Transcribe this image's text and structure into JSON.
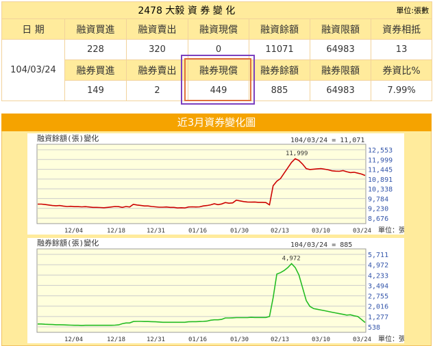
{
  "summary": {
    "title": "2478 大毅 資 券 變 化",
    "unit": "單位:張數",
    "date_header": "日 期",
    "date": "104/03/24",
    "margin_headers": [
      "融資買進",
      "融資賣出",
      "融資現償",
      "融資餘額",
      "融資限額",
      "資券相抵"
    ],
    "margin_values": [
      "228",
      "320",
      "0",
      "11071",
      "64983",
      "13"
    ],
    "short_headers": [
      "融券買進",
      "融券賣出",
      "融券現償",
      "融券餘額",
      "融券限額",
      "券資比%"
    ],
    "short_values": [
      "149",
      "2",
      "449",
      "885",
      "64983",
      "7.99%"
    ]
  },
  "panel": {
    "title": "近3月資券變化圖"
  },
  "chart_data": [
    {
      "type": "line",
      "title": "融資餘額(張)變化",
      "readout": "104/03/24 = 11,071",
      "peak_label": "11,999",
      "unit_label": "單位：張",
      "x_ticks": [
        "12/04",
        "12/18",
        "12/31",
        "01/16",
        "01/30",
        "02/13",
        "03/10",
        "03/24"
      ],
      "y_ticks": [
        "12,553",
        "11,999",
        "11,445",
        "10,891",
        "10,338",
        "9,784",
        "9,230",
        "8,676"
      ],
      "ylim": [
        8400,
        12800
      ],
      "color": "#cc0000",
      "grid": true,
      "values": [
        9480,
        9480,
        9460,
        9430,
        9400,
        9390,
        9400,
        9370,
        9350,
        9360,
        9340,
        9340,
        9330,
        9340,
        9320,
        9300,
        9300,
        9290,
        9280,
        9300,
        9320,
        9350,
        9340,
        9300,
        9350,
        9320,
        9470,
        9430,
        9410,
        9380,
        9380,
        9350,
        9330,
        9310,
        9310,
        9320,
        9300,
        9300,
        9270,
        9280,
        9270,
        9320,
        9330,
        9320,
        9330,
        9380,
        9400,
        9440,
        9500,
        9450,
        9490,
        9570,
        9530,
        9550,
        9700,
        9660,
        9620,
        9600,
        9590,
        9600,
        9580,
        9580,
        9570,
        9440,
        10500,
        10750,
        10900,
        11200,
        11500,
        11800,
        11999,
        11900,
        11700,
        11450,
        11400,
        11420,
        11440,
        11450,
        11420,
        11380,
        11330,
        11310,
        11300,
        11340,
        11280,
        11230,
        11250,
        11200,
        11150,
        11071
      ]
    },
    {
      "type": "line",
      "title": "融券餘額(張)變化",
      "readout": "104/03/24 = 885",
      "peak_label": "4,972",
      "unit_label": "單位：張",
      "x_ticks": [
        "12/04",
        "12/18",
        "12/31",
        "01/16",
        "01/30",
        "02/13",
        "03/10",
        "03/24"
      ],
      "y_ticks": [
        "5,711",
        "4,972",
        "4,233",
        "3,494",
        "2,755",
        "2,016",
        "1,277",
        "538"
      ],
      "ylim": [
        200,
        6000
      ],
      "color": "#22bb22",
      "grid": true,
      "values": [
        780,
        780,
        760,
        750,
        740,
        730,
        730,
        720,
        710,
        700,
        690,
        690,
        680,
        690,
        690,
        690,
        690,
        690,
        690,
        690,
        690,
        700,
        720,
        800,
        850,
        850,
        950,
        960,
        960,
        950,
        950,
        940,
        930,
        920,
        900,
        900,
        900,
        900,
        900,
        900,
        900,
        930,
        940,
        940,
        950,
        960,
        980,
        1040,
        1070,
        1070,
        1100,
        1200,
        1200,
        1210,
        1220,
        1220,
        1220,
        1220,
        1240,
        1230,
        1230,
        1230,
        1230,
        1300,
        2600,
        4250,
        4350,
        4500,
        4700,
        4972,
        4700,
        4200,
        3300,
        2400,
        2000,
        1850,
        1800,
        1750,
        1700,
        1650,
        1600,
        1550,
        1500,
        1450,
        1400,
        1420,
        1350,
        1300,
        1100,
        885
      ]
    }
  ]
}
